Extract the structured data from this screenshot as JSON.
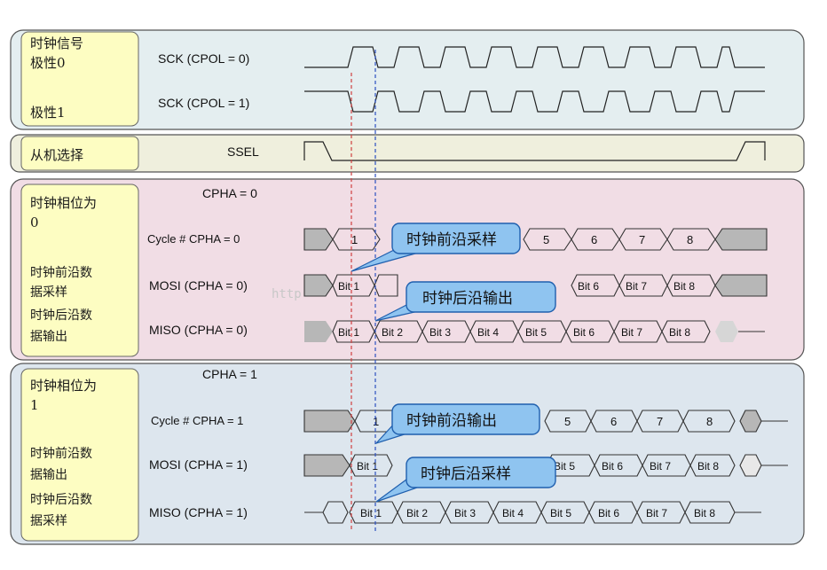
{
  "panel_labels": {
    "clock_polarity": "时钟信号",
    "polarity0": "极性0",
    "polarity1": "极性1",
    "slave_select": "从机选择",
    "cpha0_title": "时钟相位为",
    "cpha0_value": "0",
    "cpha0_mosi": "时钟前沿数",
    "cpha0_mosi2": "据采样",
    "cpha0_miso": "时钟后沿数",
    "cpha0_miso2": "据输出",
    "cpha1_title": "时钟相位为",
    "cpha1_value": "1",
    "cpha1_mosi": "时钟前沿数",
    "cpha1_mosi2": "据输出",
    "cpha1_miso": "时钟后沿数",
    "cpha1_miso2": "据采样"
  },
  "signal_labels": {
    "sck0": "SCK (CPOL = 0)",
    "sck1": "SCK (CPOL = 1)",
    "ssel": "SSEL",
    "cpha0_header": "CPHA = 0",
    "cycle0": "Cycle # CPHA = 0",
    "mosi0": "MOSI (CPHA = 0)",
    "miso0": "MISO (CPHA = 0)",
    "cpha1_header": "CPHA = 1",
    "cycle1": "Cycle # CPHA = 1",
    "mosi1": "MOSI (CPHA = 1)",
    "miso1": "MISO (CPHA = 1)"
  },
  "cycle_numbers": [
    "1",
    "5",
    "6",
    "7",
    "8"
  ],
  "bits": [
    "Bit 1",
    "Bit 2",
    "Bit 3",
    "Bit 4",
    "Bit 5",
    "Bit 6",
    "Bit 7",
    "Bit 8"
  ],
  "callouts": {
    "c1": "时钟前沿采样",
    "c2": "时钟后沿输出",
    "c3": "时钟前沿输出",
    "c4": "时钟后沿采样"
  },
  "watermark": "http",
  "colors": {
    "panel_sck": "#e4eef0",
    "panel_ssel": "#efefdd",
    "panel_cpha0": "#f1dde5",
    "panel_cpha1": "#dde6ee",
    "label_box": "#fdfdc2",
    "callout_fill": "#8fc4f0",
    "callout_stroke": "#1f5fae",
    "marker_red": "#d04040",
    "marker_blue": "#2b4fc0",
    "gray_block": "#b7b7b7"
  }
}
